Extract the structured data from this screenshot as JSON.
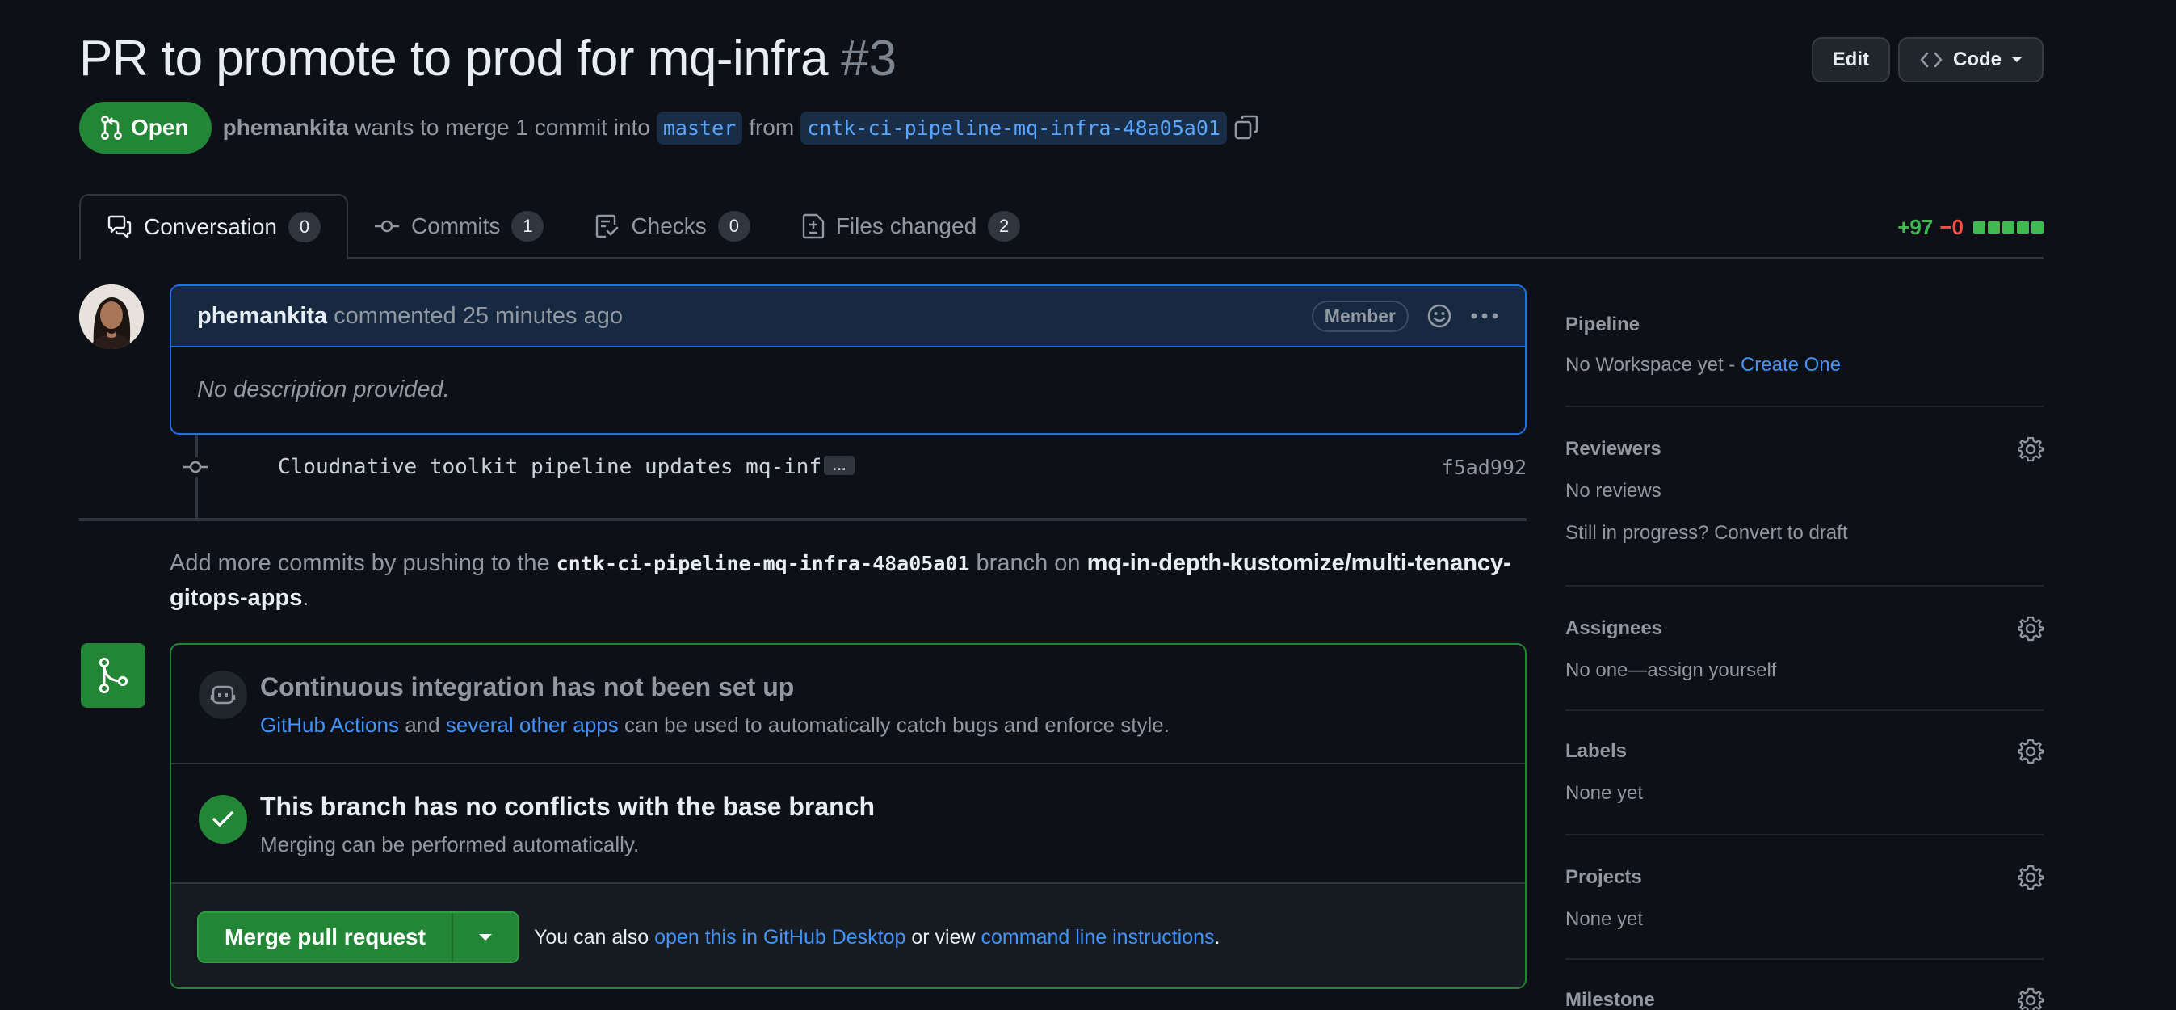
{
  "pr": {
    "title": "PR to promote to prod for mq-infra",
    "number": "#3",
    "state": "Open",
    "author": "phemankita",
    "merge_text_1": "wants to merge 1 commit into",
    "base_branch": "master",
    "merge_text_2": "from",
    "head_branch": "cntk-ci-pipeline-mq-infra-48a05a01"
  },
  "header_actions": {
    "edit_label": "Edit",
    "code_label": "Code"
  },
  "tabs": [
    {
      "label": "Conversation",
      "count": "0",
      "icon": "comment-discussion-icon"
    },
    {
      "label": "Commits",
      "count": "1",
      "icon": "git-commit-icon"
    },
    {
      "label": "Checks",
      "count": "0",
      "icon": "checklist-icon"
    },
    {
      "label": "Files changed",
      "count": "2",
      "icon": "file-diff-icon"
    }
  ],
  "diffstat": {
    "additions": "+97",
    "deletions": "−0",
    "blocks": 5
  },
  "comment": {
    "author": "phemankita",
    "action": "commented",
    "time": "25 minutes ago",
    "role_badge": "Member",
    "body": "No description provided."
  },
  "commit": {
    "message": "Cloudnative toolkit pipeline updates mq-infra",
    "ellipsis": "…",
    "sha": "f5ad992"
  },
  "push_hint": {
    "prefix": "Add more commits by pushing to the",
    "branch": "cntk-ci-pipeline-mq-infra-48a05a01",
    "middle": "branch on",
    "repo": "mq-in-depth-kustomize/multi-tenancy-gitops-apps",
    "suffix": "."
  },
  "merge_box": {
    "ci_heading": "Continuous integration has not been set up",
    "ci_link_1": "GitHub Actions",
    "ci_and": "and",
    "ci_link_2": "several other apps",
    "ci_rest": "can be used to automatically catch bugs and enforce style.",
    "conflict_heading": "This branch has no conflicts with the base branch",
    "conflict_sub": "Merging can be performed automatically.",
    "merge_button": "Merge pull request",
    "note_prefix": "You can also",
    "note_link_1": "open this in GitHub Desktop",
    "note_middle": "or view",
    "note_link_2": "command line instructions",
    "note_suffix": "."
  },
  "sidebar": {
    "pipeline_title": "Pipeline",
    "pipeline_text": "No Workspace yet -",
    "pipeline_link": "Create One",
    "reviewers_title": "Reviewers",
    "reviewers_text": "No reviews",
    "reviewers_draft": "Still in progress? Convert to draft",
    "assignees_title": "Assignees",
    "assignees_text": "No one—assign yourself",
    "labels_title": "Labels",
    "labels_text": "None yet",
    "projects_title": "Projects",
    "projects_text": "None yet",
    "milestone_title": "Milestone"
  },
  "colors": {
    "background": "#0d1117",
    "open_green": "#238636",
    "link_blue": "#4493f8",
    "addition": "#3fb950",
    "deletion": "#f85149"
  }
}
